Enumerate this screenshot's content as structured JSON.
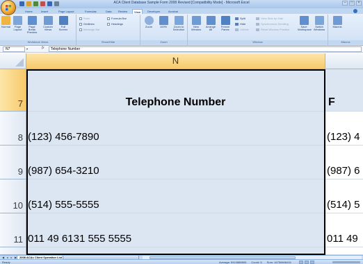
{
  "window": {
    "title": "ACA Client Database Sample Form 2008 Revised [Compatibility Mode] - Microsoft Excel",
    "controls": [
      "–",
      "□",
      "×"
    ]
  },
  "ribbon": {
    "tabs": [
      "Home",
      "Insert",
      "Page Layout",
      "Formulas",
      "Data",
      "Review",
      "View",
      "Developer",
      "Acrobat"
    ],
    "active_tab": "View",
    "groups": {
      "workbook_views": {
        "label": "Workbook Views",
        "buttons": [
          "Normal",
          "Page Layout",
          "Page Break Preview",
          "Custom Views",
          "Full Screen"
        ]
      },
      "show_hide": {
        "label": "Show/Hide",
        "items": [
          "Ruler",
          "Gridlines",
          "Message Bar",
          "Formula Bar",
          "Headings"
        ]
      },
      "zoom": {
        "label": "Zoom",
        "buttons": [
          "Zoom",
          "100%",
          "Zoom to Selection"
        ]
      },
      "window": {
        "label": "Window",
        "buttons": [
          "New Window",
          "Arrange All",
          "Freeze Panes"
        ],
        "items": [
          "Split",
          "Hide",
          "Unhide",
          "View Side by Side",
          "Synchronous Scrolling",
          "Reset Window Position"
        ],
        "save_buttons": [
          "Save Workspace",
          "Switch Windows"
        ]
      },
      "macros": {
        "label": "Macros",
        "buttons": [
          "Macros"
        ]
      }
    }
  },
  "formula_bar": {
    "name_box": "N7",
    "fx": "fx",
    "content": "Telephone Number"
  },
  "grid": {
    "column_letter": "N",
    "rows": [
      {
        "num": "7",
        "value": "Telephone Number",
        "next": "F"
      },
      {
        "num": "8",
        "value": "(123) 456-7890",
        "next": "(123) 4"
      },
      {
        "num": "9",
        "value": "(987) 654-3210",
        "next": "(987) 6"
      },
      {
        "num": "10",
        "value": "(514) 555-5555",
        "next": "(514) 5"
      },
      {
        "num": "11",
        "value": "011 49 6131 555 5555",
        "next": "011 49"
      }
    ]
  },
  "sheets": {
    "active": "2008 ACAs Client Operation List"
  },
  "status": {
    "mode": "Ready",
    "average": "Average: 5410888805",
    "count": "Count: 5",
    "sum": "Sum: 16750666415"
  }
}
